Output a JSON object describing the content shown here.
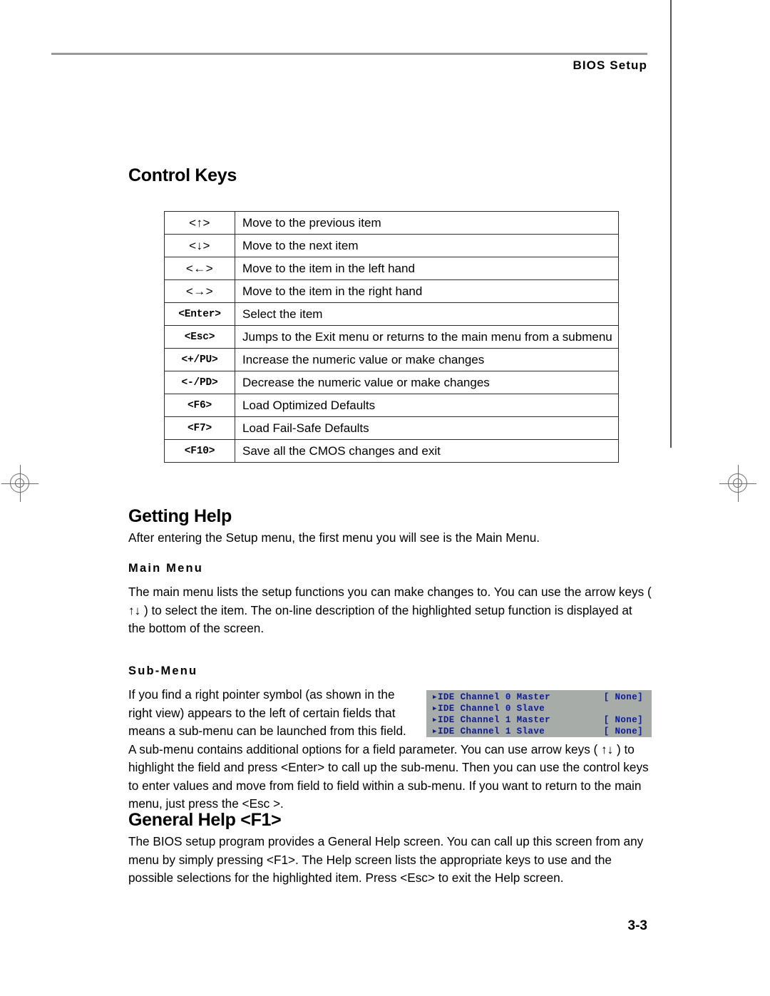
{
  "header": {
    "title": "BIOS Setup"
  },
  "sections": {
    "control_keys": {
      "heading": "Control Keys",
      "rows": [
        {
          "key": "<↑>",
          "desc": "Move to the previous item",
          "mono": false
        },
        {
          "key": "<↓>",
          "desc": "Move to the next item",
          "mono": false
        },
        {
          "key": "<←>",
          "desc": "Move to the item in the left hand",
          "mono": false
        },
        {
          "key": "<→>",
          "desc": "Move to the item in the right hand",
          "mono": false
        },
        {
          "key": "<Enter>",
          "desc": "Select the item",
          "mono": true
        },
        {
          "key": "<Esc>",
          "desc": "Jumps to the Exit menu or returns to the main menu from a submenu",
          "mono": true
        },
        {
          "key": "<+/PU>",
          "desc": "Increase the numeric value or make changes",
          "mono": true
        },
        {
          "key": "<-/PD>",
          "desc": "Decrease the numeric value or make changes",
          "mono": true
        },
        {
          "key": "<F6>",
          "desc": "Load Optimized Defaults",
          "mono": true
        },
        {
          "key": "<F7>",
          "desc": "Load Fail-Safe Defaults",
          "mono": true
        },
        {
          "key": "<F10>",
          "desc": "Save all the CMOS changes and exit",
          "mono": true
        }
      ]
    },
    "getting_help": {
      "heading": "Getting Help",
      "intro": "After entering the Setup menu, the first menu you will see is the Main Menu.",
      "main_menu": {
        "heading": "Main Menu",
        "text": "The main menu lists the setup functions you can make changes to. You can use the arrow keys ( ↑↓ ) to select the item. The on-line description of the highlighted setup function is displayed at the bottom of the screen."
      },
      "sub_menu": {
        "heading": "Sub-Menu",
        "text": "If you find a right pointer symbol (as shown in the right  view) appears to the left of certain fields that means a sub-menu can be launched from this field. A sub-menu contains additional options for a field parameter. You can use arrow keys  ( ↑↓ ) to highlight the field and press <Enter> to call up the sub-menu. Then you can use the control keys to enter values and  move from field to field within a sub-menu. If you want to return to the main menu, just press the <Esc >."
      }
    },
    "general_help": {
      "heading": "General Help <F1>",
      "text": "The BIOS setup program provides a General  Help screen. You can call up this screen from any menu by simply pressing <F1>. The Help screen lists the appropriate keys to use and the possible selections for the highlighted item. Press <Esc> to exit the Help screen."
    }
  },
  "bios_panel": {
    "background_color": "#a8aca8",
    "text_color": "#0b1a96",
    "arrow_glyph": "▶",
    "rows": [
      {
        "label": "IDE Channel 0 Master",
        "value": "[ None]"
      },
      {
        "label": "IDE Channel 0 Slave",
        "value": ""
      },
      {
        "label": "IDE Channel 1 Master",
        "value": "[ None]"
      },
      {
        "label": "IDE Channel 1 Slave",
        "value": "[ None]"
      }
    ]
  },
  "footer": {
    "page_number": "3-3"
  }
}
